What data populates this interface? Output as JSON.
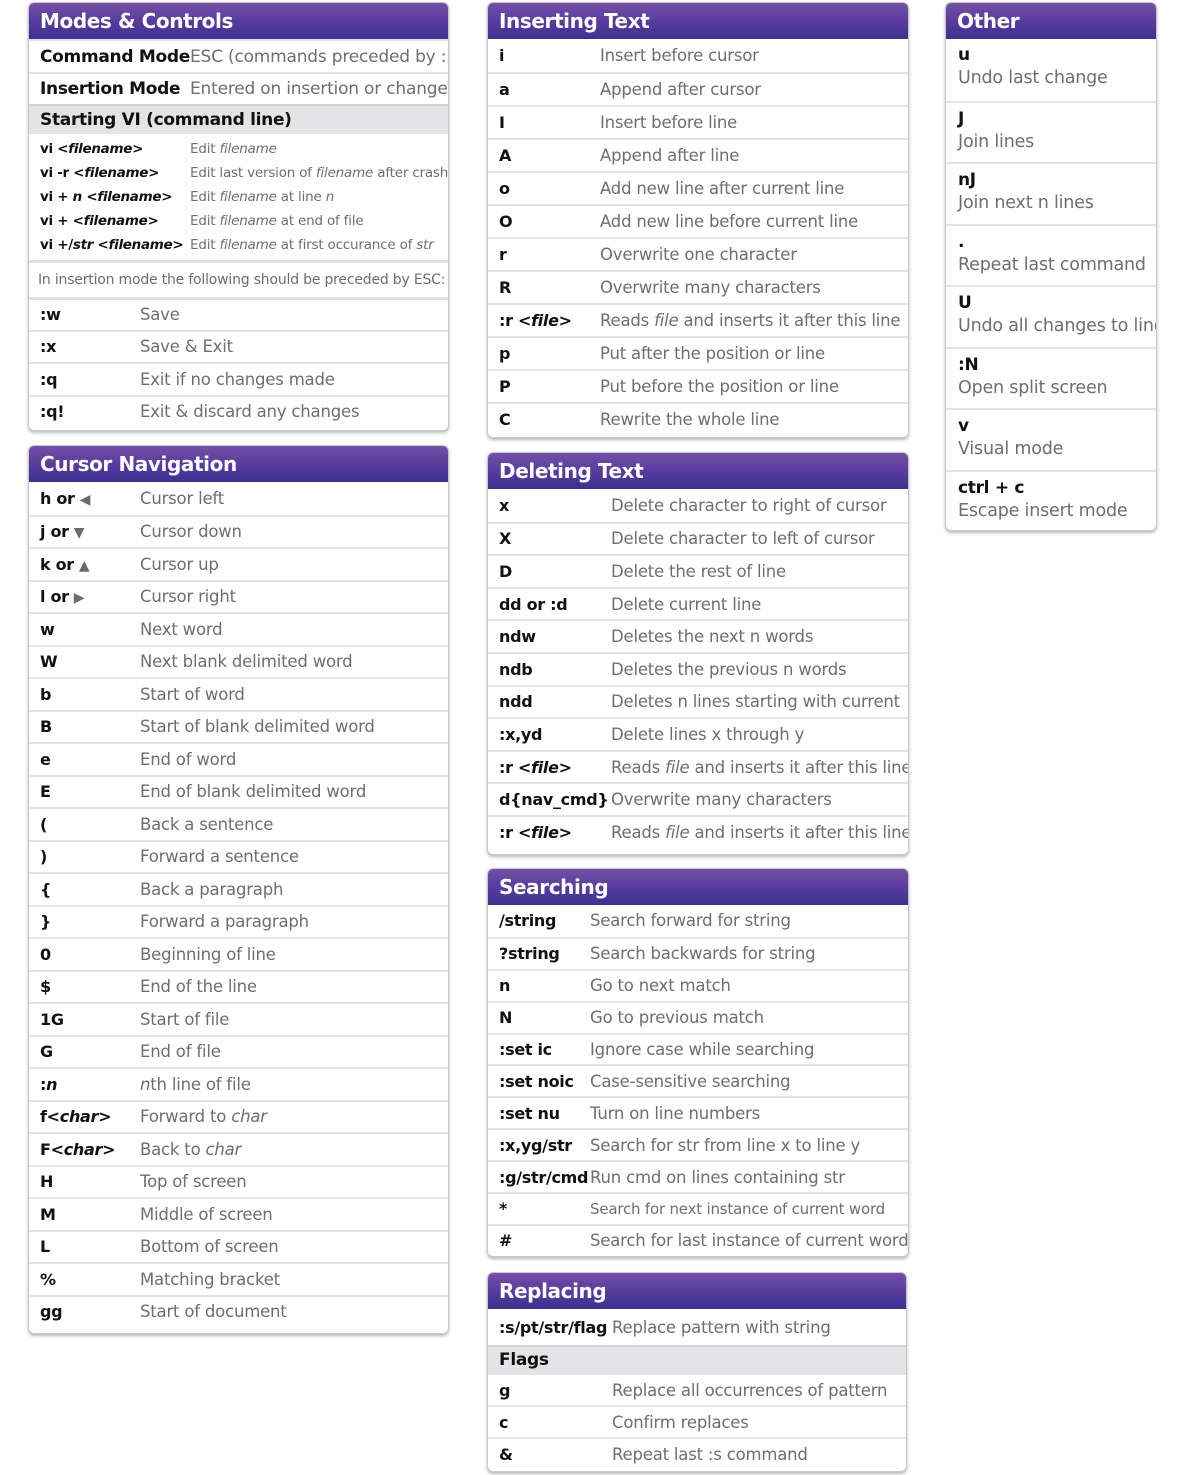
{
  "colors": {
    "header_top": "#7450a8",
    "header_bottom": "#3c3291",
    "header_text": "#ffffff",
    "key_text": "#111111",
    "desc_text": "#6e6e6e",
    "subhead_bg": "#e4e4e7"
  },
  "modes": {
    "title": "Modes & Controls",
    "modes_rows": [
      {
        "key": "Command Mode",
        "desc": "ESC (commands preceded by :)"
      },
      {
        "key": "Insertion Mode",
        "desc": "Entered on insertion or change"
      }
    ],
    "starting_heading": "Starting VI (command line)",
    "starting_rows": [
      {
        "key": [
          {
            "t": "vi <"
          },
          {
            "t": "filename",
            "i": true
          },
          {
            "t": ">"
          }
        ],
        "desc": [
          {
            "t": "Edit "
          },
          {
            "t": "filename",
            "i": true
          }
        ]
      },
      {
        "key": [
          {
            "t": "vi -r <"
          },
          {
            "t": "filename",
            "i": true
          },
          {
            "t": ">"
          }
        ],
        "desc": [
          {
            "t": "Edit last version of "
          },
          {
            "t": "filename",
            "i": true
          },
          {
            "t": " after crash"
          }
        ]
      },
      {
        "key": [
          {
            "t": "vi + "
          },
          {
            "t": "n",
            "i": true
          },
          {
            "t": " <"
          },
          {
            "t": "filename",
            "i": true
          },
          {
            "t": ">"
          }
        ],
        "desc": [
          {
            "t": "Edit "
          },
          {
            "t": "filename",
            "i": true
          },
          {
            "t": " at line "
          },
          {
            "t": "n",
            "i": true
          }
        ]
      },
      {
        "key": [
          {
            "t": "vi + <"
          },
          {
            "t": "filename",
            "i": true
          },
          {
            "t": ">"
          }
        ],
        "desc": [
          {
            "t": "Edit "
          },
          {
            "t": "filename",
            "i": true
          },
          {
            "t": " at end of file"
          }
        ]
      },
      {
        "key": [
          {
            "t": "vi +/"
          },
          {
            "t": "str",
            "i": true
          },
          {
            "t": " <"
          },
          {
            "t": "filename",
            "i": true
          },
          {
            "t": ">"
          }
        ],
        "desc": [
          {
            "t": "Edit "
          },
          {
            "t": "filename",
            "i": true
          },
          {
            "t": " at first occurance of "
          },
          {
            "t": "str",
            "i": true
          }
        ]
      }
    ],
    "note": "In insertion mode the following should be preceded by ESC:",
    "esc_rows": [
      {
        "key": ":w",
        "desc": "Save"
      },
      {
        "key": ":x",
        "desc": "Save & Exit"
      },
      {
        "key": ":q",
        "desc": "Exit if no changes made"
      },
      {
        "key": ":q!",
        "desc": "Exit & discard any changes"
      }
    ]
  },
  "cursor": {
    "title": "Cursor Navigation",
    "rows": [
      {
        "key": [
          {
            "t": "h or"
          }
        ],
        "arrow": "◀",
        "arrow_icon": "arrow-left-icon",
        "desc": [
          {
            "t": "Cursor left"
          }
        ]
      },
      {
        "key": [
          {
            "t": "j or"
          }
        ],
        "arrow": "▼",
        "arrow_icon": "arrow-down-icon",
        "desc": [
          {
            "t": "Cursor down"
          }
        ]
      },
      {
        "key": [
          {
            "t": "k or"
          }
        ],
        "arrow": "▲",
        "arrow_icon": "arrow-up-icon",
        "desc": [
          {
            "t": "Cursor up"
          }
        ]
      },
      {
        "key": [
          {
            "t": "l or"
          }
        ],
        "arrow": "▶",
        "arrow_icon": "arrow-right-icon",
        "desc": [
          {
            "t": "Cursor right"
          }
        ]
      },
      {
        "key": [
          {
            "t": "w"
          }
        ],
        "desc": [
          {
            "t": "Next word"
          }
        ]
      },
      {
        "key": [
          {
            "t": "W"
          }
        ],
        "desc": [
          {
            "t": "Next blank delimited word"
          }
        ]
      },
      {
        "key": [
          {
            "t": "b"
          }
        ],
        "desc": [
          {
            "t": "Start of word"
          }
        ]
      },
      {
        "key": [
          {
            "t": "B"
          }
        ],
        "desc": [
          {
            "t": "Start of blank delimited word"
          }
        ]
      },
      {
        "key": [
          {
            "t": "e"
          }
        ],
        "desc": [
          {
            "t": "End of word"
          }
        ]
      },
      {
        "key": [
          {
            "t": "E"
          }
        ],
        "desc": [
          {
            "t": "End of blank delimited word"
          }
        ]
      },
      {
        "key": [
          {
            "t": "("
          }
        ],
        "desc": [
          {
            "t": "Back a sentence"
          }
        ]
      },
      {
        "key": [
          {
            "t": ")"
          }
        ],
        "desc": [
          {
            "t": "Forward a sentence"
          }
        ]
      },
      {
        "key": [
          {
            "t": "{"
          }
        ],
        "desc": [
          {
            "t": "Back a paragraph"
          }
        ]
      },
      {
        "key": [
          {
            "t": "}"
          }
        ],
        "desc": [
          {
            "t": "Forward a paragraph"
          }
        ]
      },
      {
        "key": [
          {
            "t": "0"
          }
        ],
        "desc": [
          {
            "t": "Beginning of line"
          }
        ]
      },
      {
        "key": [
          {
            "t": "$"
          }
        ],
        "desc": [
          {
            "t": "End of the line"
          }
        ]
      },
      {
        "key": [
          {
            "t": "1G"
          }
        ],
        "desc": [
          {
            "t": "Start of file"
          }
        ]
      },
      {
        "key": [
          {
            "t": "G"
          }
        ],
        "desc": [
          {
            "t": "End of file"
          }
        ]
      },
      {
        "key": [
          {
            "t": ":"
          },
          {
            "t": "n",
            "i": true
          }
        ],
        "desc": [
          {
            "t": "n",
            "i": true
          },
          {
            "t": "th line of file"
          }
        ]
      },
      {
        "key": [
          {
            "t": "f<"
          },
          {
            "t": "char",
            "i": true
          },
          {
            "t": ">"
          }
        ],
        "desc": [
          {
            "t": "Forward to "
          },
          {
            "t": "char",
            "i": true
          }
        ]
      },
      {
        "key": [
          {
            "t": "F<"
          },
          {
            "t": "char",
            "i": true
          },
          {
            "t": ">"
          }
        ],
        "desc": [
          {
            "t": "Back to "
          },
          {
            "t": "char",
            "i": true
          }
        ]
      },
      {
        "key": [
          {
            "t": "H"
          }
        ],
        "desc": [
          {
            "t": "Top of screen"
          }
        ]
      },
      {
        "key": [
          {
            "t": "M"
          }
        ],
        "desc": [
          {
            "t": "Middle of screen"
          }
        ]
      },
      {
        "key": [
          {
            "t": "L"
          }
        ],
        "desc": [
          {
            "t": "Bottom of screen"
          }
        ]
      },
      {
        "key": [
          {
            "t": "%"
          }
        ],
        "desc": [
          {
            "t": "Matching bracket"
          }
        ]
      },
      {
        "key": [
          {
            "t": "gg"
          }
        ],
        "desc": [
          {
            "t": "Start of document"
          }
        ]
      }
    ]
  },
  "inserting": {
    "title": "Inserting Text",
    "rows": [
      {
        "key": [
          {
            "t": "i"
          }
        ],
        "desc": [
          {
            "t": "Insert before cursor"
          }
        ]
      },
      {
        "key": [
          {
            "t": "a"
          }
        ],
        "desc": [
          {
            "t": "Append after cursor"
          }
        ]
      },
      {
        "key": [
          {
            "t": "I"
          }
        ],
        "desc": [
          {
            "t": "Insert before line"
          }
        ]
      },
      {
        "key": [
          {
            "t": "A"
          }
        ],
        "desc": [
          {
            "t": "Append after line"
          }
        ]
      },
      {
        "key": [
          {
            "t": "o"
          }
        ],
        "desc": [
          {
            "t": "Add new line after current line"
          }
        ]
      },
      {
        "key": [
          {
            "t": "O"
          }
        ],
        "desc": [
          {
            "t": "Add new line before current line"
          }
        ]
      },
      {
        "key": [
          {
            "t": "r"
          }
        ],
        "desc": [
          {
            "t": "Overwrite one character"
          }
        ]
      },
      {
        "key": [
          {
            "t": "R"
          }
        ],
        "desc": [
          {
            "t": "Overwrite many characters"
          }
        ]
      },
      {
        "key": [
          {
            "t": ":r <"
          },
          {
            "t": "file",
            "i": true
          },
          {
            "t": ">"
          }
        ],
        "desc": [
          {
            "t": "Reads "
          },
          {
            "t": "file",
            "i": true
          },
          {
            "t": " and inserts it after this line"
          }
        ]
      },
      {
        "key": [
          {
            "t": "p"
          }
        ],
        "desc": [
          {
            "t": "Put after the position or line"
          }
        ]
      },
      {
        "key": [
          {
            "t": "P"
          }
        ],
        "desc": [
          {
            "t": "Put before the position or line"
          }
        ]
      },
      {
        "key": [
          {
            "t": "C"
          }
        ],
        "desc": [
          {
            "t": "Rewrite the whole line"
          }
        ]
      }
    ]
  },
  "deleting": {
    "title": "Deleting Text",
    "rows": [
      {
        "key": [
          {
            "t": "x"
          }
        ],
        "desc": [
          {
            "t": "Delete character to right of cursor"
          }
        ]
      },
      {
        "key": [
          {
            "t": "X"
          }
        ],
        "desc": [
          {
            "t": "Delete character to left of cursor"
          }
        ]
      },
      {
        "key": [
          {
            "t": "D"
          }
        ],
        "desc": [
          {
            "t": "Delete the rest of line"
          }
        ]
      },
      {
        "key": [
          {
            "t": "dd or :d"
          }
        ],
        "desc": [
          {
            "t": "Delete current line"
          }
        ]
      },
      {
        "key": [
          {
            "t": "ndw"
          }
        ],
        "desc": [
          {
            "t": "Deletes the next n words"
          }
        ]
      },
      {
        "key": [
          {
            "t": "ndb"
          }
        ],
        "desc": [
          {
            "t": "Deletes the previous n words"
          }
        ]
      },
      {
        "key": [
          {
            "t": "ndd"
          }
        ],
        "desc": [
          {
            "t": "Deletes n lines starting with current"
          }
        ]
      },
      {
        "key": [
          {
            "t": ":x,yd"
          }
        ],
        "desc": [
          {
            "t": "Delete lines x through y"
          }
        ]
      },
      {
        "key": [
          {
            "t": ":r <"
          },
          {
            "t": "file",
            "i": true
          },
          {
            "t": ">"
          }
        ],
        "desc": [
          {
            "t": "Reads "
          },
          {
            "t": "file",
            "i": true
          },
          {
            "t": " and inserts it after this line"
          }
        ]
      },
      {
        "key": [
          {
            "t": "d{nav_cmd}"
          }
        ],
        "desc": [
          {
            "t": "Overwrite many characters"
          }
        ]
      },
      {
        "key": [
          {
            "t": ":r <"
          },
          {
            "t": "file",
            "i": true
          },
          {
            "t": ">"
          }
        ],
        "desc": [
          {
            "t": "Reads "
          },
          {
            "t": "file",
            "i": true
          },
          {
            "t": " and inserts it after this line"
          }
        ]
      }
    ]
  },
  "searching": {
    "title": "Searching",
    "rows": [
      {
        "key": [
          {
            "t": "/string"
          }
        ],
        "desc": [
          {
            "t": "Search forward for string"
          }
        ]
      },
      {
        "key": [
          {
            "t": "?string"
          }
        ],
        "desc": [
          {
            "t": "Search backwards for string"
          }
        ]
      },
      {
        "key": [
          {
            "t": "n"
          }
        ],
        "desc": [
          {
            "t": "Go to next match"
          }
        ]
      },
      {
        "key": [
          {
            "t": "N"
          }
        ],
        "desc": [
          {
            "t": "Go to previous match"
          }
        ]
      },
      {
        "key": [
          {
            "t": ":set ic"
          }
        ],
        "desc": [
          {
            "t": "Ignore case while searching"
          }
        ]
      },
      {
        "key": [
          {
            "t": ":set noic"
          }
        ],
        "desc": [
          {
            "t": "Case-sensitive searching"
          }
        ]
      },
      {
        "key": [
          {
            "t": ":set nu"
          }
        ],
        "desc": [
          {
            "t": "Turn on line numbers"
          }
        ]
      },
      {
        "key": [
          {
            "t": ":x,yg/str"
          }
        ],
        "desc": [
          {
            "t": "Search for str from line x to line y"
          }
        ]
      },
      {
        "key": [
          {
            "t": ":g/str/cmd"
          }
        ],
        "desc": [
          {
            "t": "Run cmd on lines containing str"
          }
        ]
      },
      {
        "key": [
          {
            "t": "*"
          }
        ],
        "desc": [
          {
            "t": "Search for next instance of current word"
          }
        ],
        "small": true
      },
      {
        "key": [
          {
            "t": "#"
          }
        ],
        "desc": [
          {
            "t": "Search for last instance of current word"
          }
        ]
      }
    ]
  },
  "replacing": {
    "title": "Replacing",
    "main_row": {
      "key": [
        {
          "t": ":s/pt/str/flag"
        }
      ],
      "desc": [
        {
          "t": "Replace pattern with string"
        }
      ]
    },
    "flags_heading": "Flags",
    "flag_rows": [
      {
        "key": [
          {
            "t": "g"
          }
        ],
        "desc": [
          {
            "t": "Replace all occurrences of pattern"
          }
        ]
      },
      {
        "key": [
          {
            "t": "c"
          }
        ],
        "desc": [
          {
            "t": "Confirm replaces"
          }
        ]
      },
      {
        "key": [
          {
            "t": "&"
          }
        ],
        "desc": [
          {
            "t": "Repeat last :s command"
          }
        ]
      }
    ]
  },
  "other": {
    "title": "Other",
    "rows": [
      {
        "key": [
          {
            "t": "u"
          }
        ],
        "desc": [
          {
            "t": "Undo last change"
          }
        ]
      },
      {
        "key": [
          {
            "t": "J"
          }
        ],
        "desc": [
          {
            "t": "Join lines"
          }
        ]
      },
      {
        "key": [
          {
            "t": "nJ"
          }
        ],
        "desc": [
          {
            "t": "Join next n lines"
          }
        ]
      },
      {
        "key": [
          {
            "t": "."
          }
        ],
        "desc": [
          {
            "t": "Repeat last command"
          }
        ]
      },
      {
        "key": [
          {
            "t": "U"
          }
        ],
        "desc": [
          {
            "t": "Undo all changes to line"
          }
        ]
      },
      {
        "key": [
          {
            "t": ":N"
          }
        ],
        "desc": [
          {
            "t": "Open split screen"
          }
        ]
      },
      {
        "key": [
          {
            "t": "v"
          }
        ],
        "desc": [
          {
            "t": "Visual mode"
          }
        ]
      },
      {
        "key": [
          {
            "t": "ctrl + c"
          }
        ],
        "desc": [
          {
            "t": "Escape insert mode"
          }
        ]
      }
    ]
  }
}
